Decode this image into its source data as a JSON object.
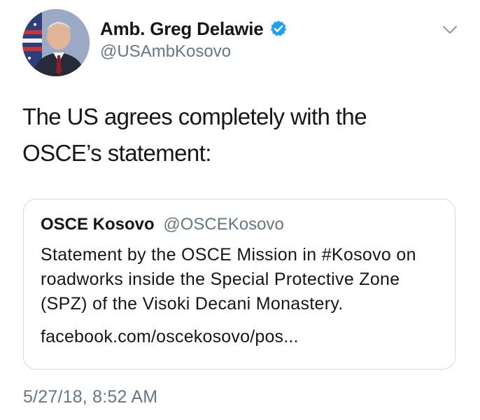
{
  "author": {
    "display_name": "Amb. Greg Delawie",
    "handle": "@USAmbKosovo",
    "verified": true,
    "verified_icon": "verified-badge-icon"
  },
  "tweet": {
    "text": "The US agrees completely with the\nOSCE’s statement:",
    "timestamp": "5/27/18, 8:52 AM"
  },
  "quoted_tweet": {
    "display_name": "OSCE Kosovo",
    "handle": "@OSCEKosovo",
    "text": "Statement by the OSCE Mission in #Kosovo on roadworks inside the Special Protective Zone (SPZ) of the Visoki Decani Monastery.",
    "link": "facebook.com/oscekosovo/pos..."
  },
  "colors": {
    "text": "#14171a",
    "secondary": "#657786",
    "border": "#d3dbe2",
    "verified": "#1da1f2"
  }
}
